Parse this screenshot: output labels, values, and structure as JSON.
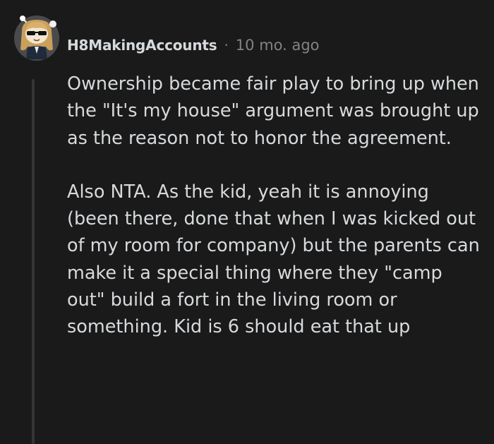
{
  "comment": {
    "author": "H8MakingAccounts",
    "separator": "·",
    "timestamp": "10 mo. ago",
    "avatar_icon": "snoo-avatar-icon",
    "paragraphs": [
      "Ownership became fair play to bring up when the \"It's my house\" argument was brought up as the reason not to honor the agreement.",
      "Also NTA. As the kid, yeah it is annoying (been there, done that when I was kicked out of my room for company) but the parents can make it a special thing where they \"camp out\" build a fort in the living room or something. Kid is 6 should eat that up"
    ]
  },
  "colors": {
    "background": "#1a1a1b",
    "text": "#d7dadc",
    "meta": "#818384",
    "thread_line": "#343536"
  }
}
